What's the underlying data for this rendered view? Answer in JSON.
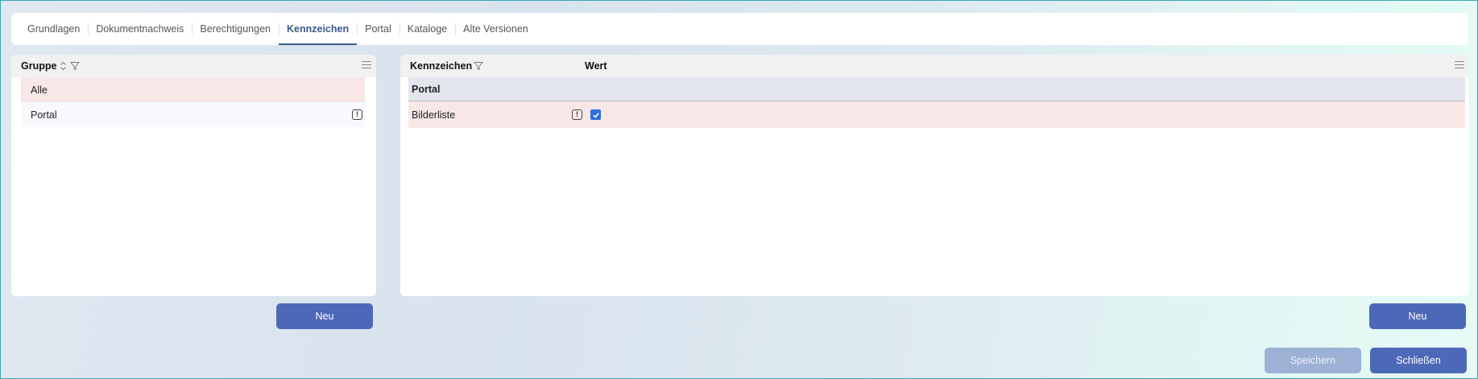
{
  "tabs": [
    {
      "label": "Grundlagen",
      "active": false
    },
    {
      "label": "Dokumentnachweis",
      "active": false
    },
    {
      "label": "Berechtigungen",
      "active": false
    },
    {
      "label": "Kennzeichen",
      "active": true
    },
    {
      "label": "Portal",
      "active": false
    },
    {
      "label": "Kataloge",
      "active": false
    },
    {
      "label": "Alte Versionen",
      "active": false
    }
  ],
  "left_panel": {
    "header": "Gruppe",
    "rows": [
      {
        "label": "Alle",
        "selected": true
      },
      {
        "label": "Portal",
        "selected": false,
        "badge": "!"
      }
    ],
    "new_button": "Neu"
  },
  "right_panel": {
    "header_kennzeichen": "Kennzeichen",
    "header_wert": "Wert",
    "group_label": "Portal",
    "rows": [
      {
        "label": "Bilderliste",
        "badge": "!",
        "checked": true
      }
    ],
    "new_button": "Neu"
  },
  "footer": {
    "save": "Speichern",
    "close": "Schließen"
  },
  "colors": {
    "accent": "#4e68b8",
    "active_tab": "#3c5a8c",
    "selected_row": "#f7e7e6",
    "checkbox": "#2f6fe0"
  }
}
